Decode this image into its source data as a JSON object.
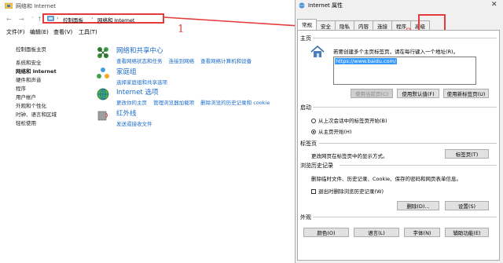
{
  "cp": {
    "title": "网络和 Internet",
    "breadcrumb": [
      "控制面板",
      "网络和 Internet"
    ],
    "menu": [
      "文件(F)",
      "编辑(E)",
      "查看(V)",
      "工具(T)"
    ],
    "left_nav": [
      "控制面板主页",
      "系统和安全",
      "网络和 Internet",
      "硬件和声音",
      "程序",
      "用户帐户",
      "外观和个性化",
      "时钟、语言和区域",
      "轻松使用"
    ],
    "sections": [
      {
        "title": "网络和共享中心",
        "links": [
          "查看网络状态和任务",
          "连接到网络",
          "查看网络计算机和设备"
        ]
      },
      {
        "title": "家庭组",
        "links": [
          "选择家庭组和共享选项"
        ]
      },
      {
        "title": "Internet 选项",
        "links": [
          "更改你的主页",
          "管理浏览器加载项",
          "删除浏览的历史记录和 cookie"
        ]
      },
      {
        "title": "红外线",
        "links": [
          "发送或接收文件"
        ]
      }
    ]
  },
  "dialog": {
    "title": "Internet 属性",
    "close": "✕",
    "tabs": [
      "常规",
      "安全",
      "隐私",
      "内容",
      "连接",
      "程序",
      "高级"
    ],
    "home": {
      "label": "主页",
      "desc": "若要创建多个主页标签页，请在每行键入一个地址(R)。",
      "url": "https://www.baidu.com/",
      "buttons": [
        "使用当前页(C)",
        "使用默认值(F)",
        "使用新标签页(U)"
      ]
    },
    "startup": {
      "label": "启动",
      "options": [
        "从上次会话中的标签页开始(B)",
        "从主页开始(H)"
      ]
    },
    "tabs_group": {
      "label": "标签页",
      "desc": "更改网页在标签页中的显示方式。",
      "button": "标签页(T)"
    },
    "history": {
      "label": "浏览历史记录",
      "desc": "删除临时文件、历史记录、Cookie、保存的密码和网页表单信息。",
      "checkbox": "退出时删除浏览历史记录(W)",
      "buttons": [
        "删除(D)...",
        "设置(S)"
      ]
    },
    "appearance": {
      "label": "外观",
      "buttons": [
        "颜色(O)",
        "语言(L)",
        "字体(N)",
        "辅助功能(E)"
      ]
    }
  },
  "annotations": {
    "one": "1",
    "two": "2"
  },
  "colors": {
    "accent": "#1a6bc8",
    "annotation": "#e63b3b"
  }
}
